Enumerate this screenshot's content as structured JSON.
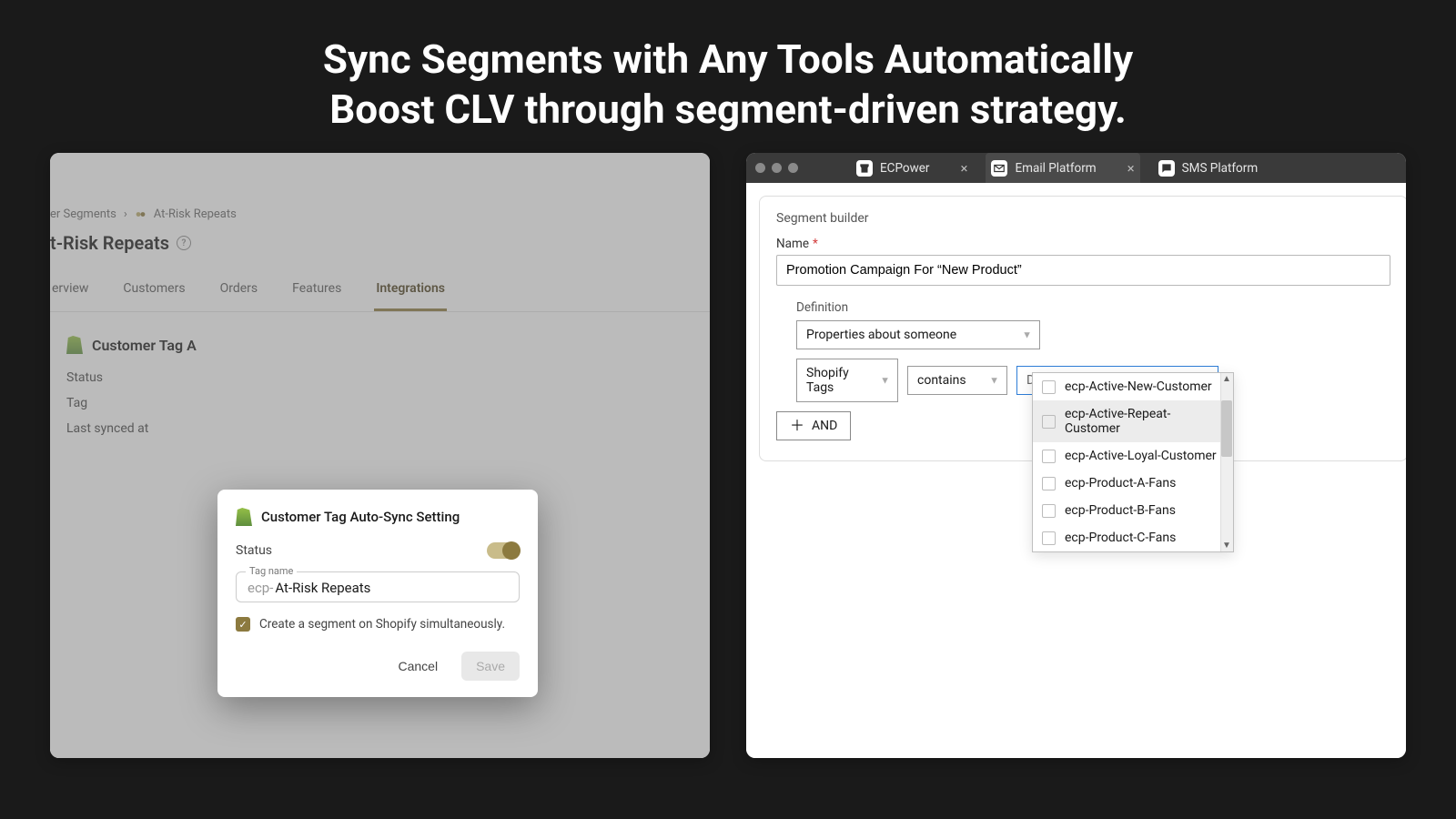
{
  "hero": {
    "line1": "Sync Segments with Any Tools Automatically",
    "line2": "Boost CLV through segment-driven strategy."
  },
  "left": {
    "breadcrumb": {
      "parent_fragment": "er Segments",
      "current": "At-Risk Repeats"
    },
    "page_title_fragment": "t-Risk Repeats",
    "tabs": [
      "erview",
      "Customers",
      "Orders",
      "Features",
      "Integrations"
    ],
    "active_tab_index": 4,
    "section_title_fragment": "Customer Tag A",
    "kv_labels": [
      "Status",
      "Tag",
      "Last synced at"
    ],
    "modal": {
      "title": "Customer Tag Auto-Sync Setting",
      "status_label": "Status",
      "tag_label": "Tag name",
      "tag_prefix": "ecp-",
      "tag_value": "At-Risk Repeats",
      "checkbox_label": "Create a segment on Shopify simultaneously.",
      "cancel": "Cancel",
      "save": "Save"
    }
  },
  "right": {
    "tabs": [
      {
        "label": "ECPower",
        "icon": "store"
      },
      {
        "label": "Email Platform",
        "icon": "mail"
      },
      {
        "label": "SMS Platform",
        "icon": "chat"
      }
    ],
    "active_tab_index": 1,
    "builder_title": "Segment builder",
    "name_label": "Name",
    "name_value": "Promotion Campaign For “New Product”",
    "definition_label": "Definition",
    "sel_properties": "Properties about someone",
    "sel_tags": "Shopify Tags",
    "sel_contains": "contains",
    "sel_dimension": "Dimension Value",
    "and_label": "AND",
    "options": [
      "ecp-Active-New-Customer",
      "ecp-Active-Repeat-Customer",
      "ecp-Active-Loyal-Customer",
      "ecp-Product-A-Fans",
      "ecp-Product-B-Fans",
      "ecp-Product-C-Fans"
    ],
    "hover_option_index": 1
  }
}
